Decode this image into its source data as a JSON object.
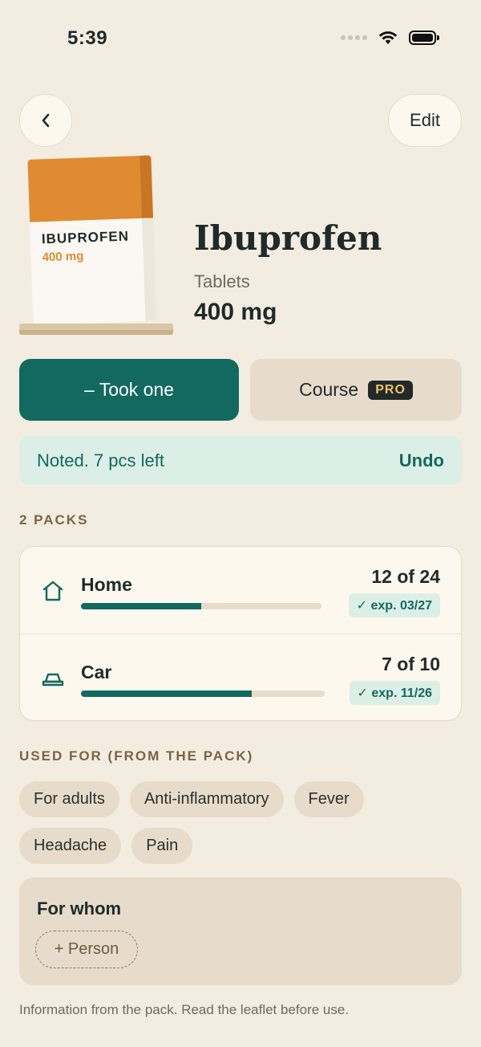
{
  "status_bar": {
    "time": "5:39"
  },
  "nav": {
    "back_label": "‹",
    "edit_label": "Edit"
  },
  "medicine": {
    "box_name": "IBUPROFEN",
    "box_dose": "400 mg",
    "name": "Ibuprofen",
    "form": "Tablets",
    "strength": "400 mg"
  },
  "actions": {
    "took_one": "– Took one",
    "course": "Course",
    "pro_badge": "PRO"
  },
  "toast": {
    "message": "Noted. 7 pcs left",
    "undo": "Undo"
  },
  "packs": {
    "heading": "2 PACKS",
    "items": [
      {
        "name": "Home",
        "count": "12 of 24",
        "expiry": "✓ exp. 03/27",
        "fill": 0.5,
        "icon": "house-icon"
      },
      {
        "name": "Car",
        "count": "7 of 10",
        "expiry": "✓ exp. 11/26",
        "fill": 0.7,
        "icon": "car-icon"
      }
    ]
  },
  "used_for": {
    "heading": "USED FOR (FROM THE PACK)",
    "chips": [
      "For adults",
      "Anti-inflammatory",
      "Fever",
      "Headache",
      "Pain"
    ]
  },
  "for_whom": {
    "title": "For whom",
    "add_person": "+ Person"
  },
  "footer": "Information from the pack. Read the leaflet before use.",
  "colors": {
    "accent": "#12695f",
    "background": "#f3ece1",
    "orange": "#e08b31"
  }
}
